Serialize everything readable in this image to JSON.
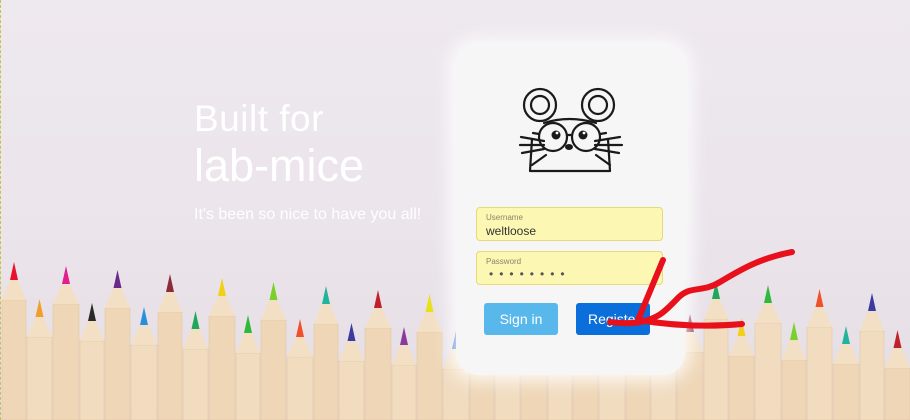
{
  "hero": {
    "line1": "Built for",
    "line2": "lab-mice",
    "tagline": "It's been so nice to have you all!"
  },
  "login": {
    "username_label": "Username",
    "username_value": "weltloose",
    "password_label": "Password",
    "password_mask": "••••••••",
    "signin_label": "Sign in",
    "register_label": "Register"
  },
  "icons": {
    "logo": "mouse-with-glasses-icon",
    "annotation": "red-arrow-icon"
  },
  "colors": {
    "signin": "#58b8ec",
    "register": "#0a6edb",
    "field_fill": "#fdf7b4",
    "annotation": "#e8101a"
  }
}
